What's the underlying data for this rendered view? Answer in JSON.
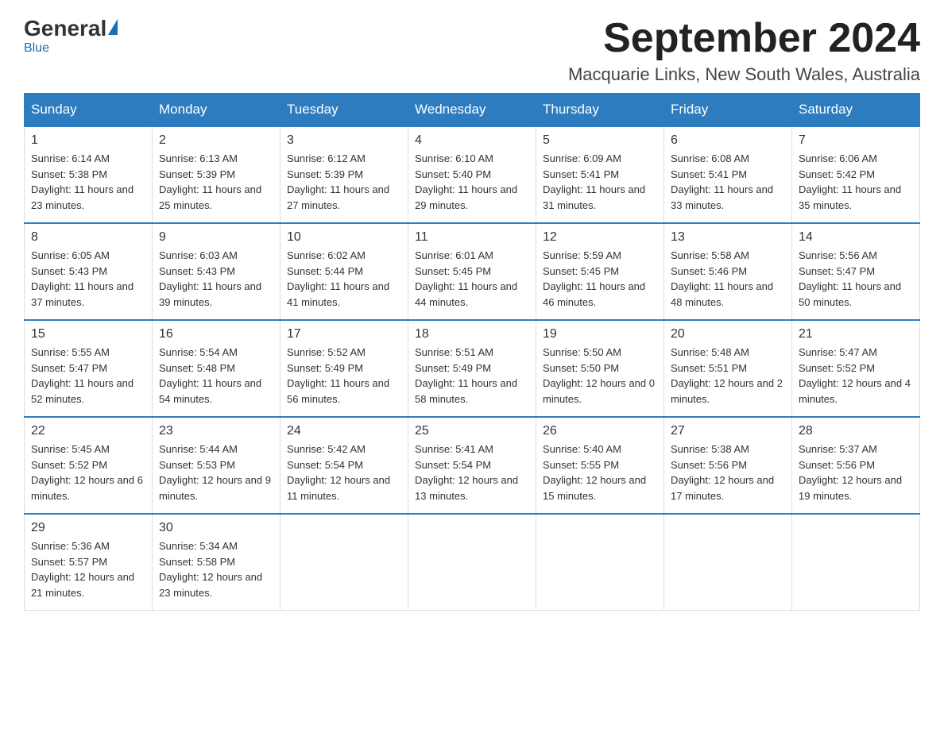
{
  "header": {
    "logo_general": "General",
    "logo_blue": "Blue",
    "month_title": "September 2024",
    "location": "Macquarie Links, New South Wales, Australia"
  },
  "days_of_week": [
    "Sunday",
    "Monday",
    "Tuesday",
    "Wednesday",
    "Thursday",
    "Friday",
    "Saturday"
  ],
  "weeks": [
    [
      {
        "day": "1",
        "sunrise": "6:14 AM",
        "sunset": "5:38 PM",
        "daylight": "11 hours and 23 minutes."
      },
      {
        "day": "2",
        "sunrise": "6:13 AM",
        "sunset": "5:39 PM",
        "daylight": "11 hours and 25 minutes."
      },
      {
        "day": "3",
        "sunrise": "6:12 AM",
        "sunset": "5:39 PM",
        "daylight": "11 hours and 27 minutes."
      },
      {
        "day": "4",
        "sunrise": "6:10 AM",
        "sunset": "5:40 PM",
        "daylight": "11 hours and 29 minutes."
      },
      {
        "day": "5",
        "sunrise": "6:09 AM",
        "sunset": "5:41 PM",
        "daylight": "11 hours and 31 minutes."
      },
      {
        "day": "6",
        "sunrise": "6:08 AM",
        "sunset": "5:41 PM",
        "daylight": "11 hours and 33 minutes."
      },
      {
        "day": "7",
        "sunrise": "6:06 AM",
        "sunset": "5:42 PM",
        "daylight": "11 hours and 35 minutes."
      }
    ],
    [
      {
        "day": "8",
        "sunrise": "6:05 AM",
        "sunset": "5:43 PM",
        "daylight": "11 hours and 37 minutes."
      },
      {
        "day": "9",
        "sunrise": "6:03 AM",
        "sunset": "5:43 PM",
        "daylight": "11 hours and 39 minutes."
      },
      {
        "day": "10",
        "sunrise": "6:02 AM",
        "sunset": "5:44 PM",
        "daylight": "11 hours and 41 minutes."
      },
      {
        "day": "11",
        "sunrise": "6:01 AM",
        "sunset": "5:45 PM",
        "daylight": "11 hours and 44 minutes."
      },
      {
        "day": "12",
        "sunrise": "5:59 AM",
        "sunset": "5:45 PM",
        "daylight": "11 hours and 46 minutes."
      },
      {
        "day": "13",
        "sunrise": "5:58 AM",
        "sunset": "5:46 PM",
        "daylight": "11 hours and 48 minutes."
      },
      {
        "day": "14",
        "sunrise": "5:56 AM",
        "sunset": "5:47 PM",
        "daylight": "11 hours and 50 minutes."
      }
    ],
    [
      {
        "day": "15",
        "sunrise": "5:55 AM",
        "sunset": "5:47 PM",
        "daylight": "11 hours and 52 minutes."
      },
      {
        "day": "16",
        "sunrise": "5:54 AM",
        "sunset": "5:48 PM",
        "daylight": "11 hours and 54 minutes."
      },
      {
        "day": "17",
        "sunrise": "5:52 AM",
        "sunset": "5:49 PM",
        "daylight": "11 hours and 56 minutes."
      },
      {
        "day": "18",
        "sunrise": "5:51 AM",
        "sunset": "5:49 PM",
        "daylight": "11 hours and 58 minutes."
      },
      {
        "day": "19",
        "sunrise": "5:50 AM",
        "sunset": "5:50 PM",
        "daylight": "12 hours and 0 minutes."
      },
      {
        "day": "20",
        "sunrise": "5:48 AM",
        "sunset": "5:51 PM",
        "daylight": "12 hours and 2 minutes."
      },
      {
        "day": "21",
        "sunrise": "5:47 AM",
        "sunset": "5:52 PM",
        "daylight": "12 hours and 4 minutes."
      }
    ],
    [
      {
        "day": "22",
        "sunrise": "5:45 AM",
        "sunset": "5:52 PM",
        "daylight": "12 hours and 6 minutes."
      },
      {
        "day": "23",
        "sunrise": "5:44 AM",
        "sunset": "5:53 PM",
        "daylight": "12 hours and 9 minutes."
      },
      {
        "day": "24",
        "sunrise": "5:42 AM",
        "sunset": "5:54 PM",
        "daylight": "12 hours and 11 minutes."
      },
      {
        "day": "25",
        "sunrise": "5:41 AM",
        "sunset": "5:54 PM",
        "daylight": "12 hours and 13 minutes."
      },
      {
        "day": "26",
        "sunrise": "5:40 AM",
        "sunset": "5:55 PM",
        "daylight": "12 hours and 15 minutes."
      },
      {
        "day": "27",
        "sunrise": "5:38 AM",
        "sunset": "5:56 PM",
        "daylight": "12 hours and 17 minutes."
      },
      {
        "day": "28",
        "sunrise": "5:37 AM",
        "sunset": "5:56 PM",
        "daylight": "12 hours and 19 minutes."
      }
    ],
    [
      {
        "day": "29",
        "sunrise": "5:36 AM",
        "sunset": "5:57 PM",
        "daylight": "12 hours and 21 minutes."
      },
      {
        "day": "30",
        "sunrise": "5:34 AM",
        "sunset": "5:58 PM",
        "daylight": "12 hours and 23 minutes."
      },
      null,
      null,
      null,
      null,
      null
    ]
  ]
}
